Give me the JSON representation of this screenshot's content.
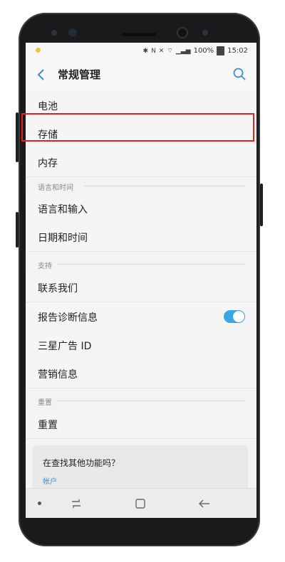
{
  "status_bar": {
    "battery": "100%",
    "time": "15:02"
  },
  "header": {
    "title": "常规管理"
  },
  "items": {
    "battery": "电池",
    "storage": "存储",
    "memory": "内存",
    "language_input": "语言和输入",
    "date_time": "日期和时间",
    "contact_us": "联系我们",
    "diagnostics": "报告诊断信息",
    "ad_id": "三星广告 ID",
    "marketing": "营销信息",
    "reset": "重置"
  },
  "sections": {
    "language_time": "语言和时间",
    "support": "支持",
    "reset": "重置"
  },
  "toggles": {
    "diagnostics_on": true
  },
  "card": {
    "title": "在查找其他功能吗？",
    "link": "帐户"
  },
  "colors": {
    "accent": "#3ba7e2",
    "highlight": "#e3231b"
  }
}
